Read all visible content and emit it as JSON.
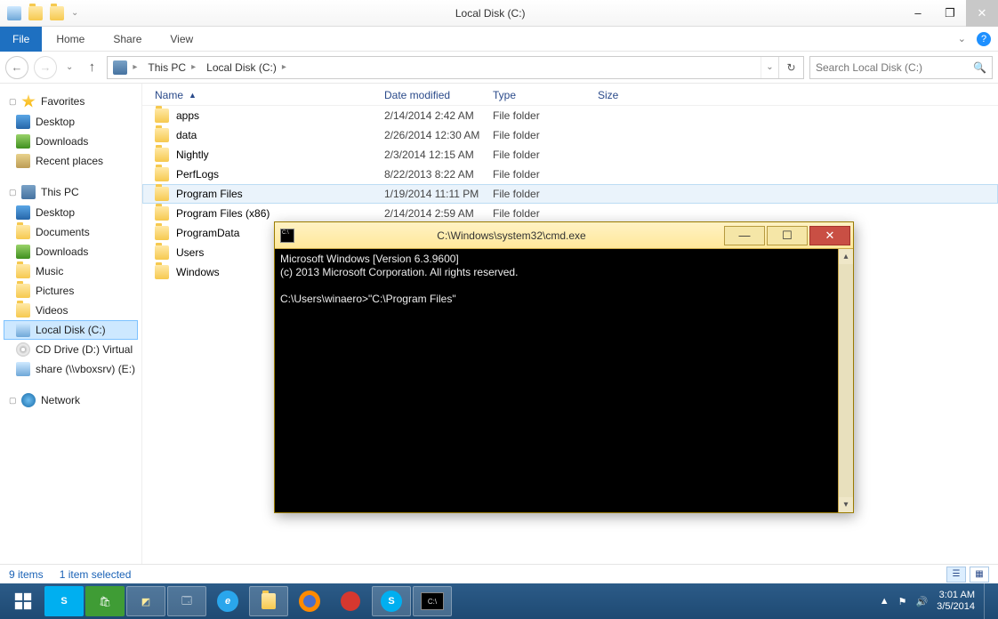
{
  "window": {
    "title": "Local Disk (C:)",
    "min_label": "–",
    "max_label": "❐",
    "close_label": "✕"
  },
  "menu": {
    "file": "File",
    "home": "Home",
    "share": "Share",
    "view": "View"
  },
  "address": {
    "root": "This PC",
    "current": "Local Disk (C:)"
  },
  "search": {
    "placeholder": "Search Local Disk (C:)"
  },
  "sidebar": {
    "favorites": "Favorites",
    "fav_items": [
      "Desktop",
      "Downloads",
      "Recent places"
    ],
    "thispc": "This PC",
    "pc_items": [
      "Desktop",
      "Documents",
      "Downloads",
      "Music",
      "Pictures",
      "Videos",
      "Local Disk (C:)",
      "CD Drive (D:) Virtual",
      "share (\\\\vboxsrv) (E:)"
    ],
    "network": "Network"
  },
  "columns": {
    "name": "Name",
    "date": "Date modified",
    "type": "Type",
    "size": "Size"
  },
  "rows": [
    {
      "name": "apps",
      "date": "2/14/2014 2:42 AM",
      "type": "File folder"
    },
    {
      "name": "data",
      "date": "2/26/2014 12:30 AM",
      "type": "File folder"
    },
    {
      "name": "Nightly",
      "date": "2/3/2014 12:15 AM",
      "type": "File folder"
    },
    {
      "name": "PerfLogs",
      "date": "8/22/2013 8:22 AM",
      "type": "File folder"
    },
    {
      "name": "Program Files",
      "date": "1/19/2014 11:11 PM",
      "type": "File folder",
      "selected": true
    },
    {
      "name": "Program Files (x86)",
      "date": "2/14/2014 2:59 AM",
      "type": "File folder"
    },
    {
      "name": "ProgramData",
      "date": "",
      "type": ""
    },
    {
      "name": "Users",
      "date": "",
      "type": ""
    },
    {
      "name": "Windows",
      "date": "",
      "type": ""
    }
  ],
  "status": {
    "items": "9 items",
    "selected": "1 item selected"
  },
  "cmd": {
    "title": "C:\\Windows\\system32\\cmd.exe",
    "line1": "Microsoft Windows [Version 6.3.9600]",
    "line2": "(c) 2013 Microsoft Corporation. All rights reserved.",
    "prompt": "C:\\Users\\winaero>\"C:\\Program Files\""
  },
  "tray": {
    "time": "3:01 AM",
    "date": "3/5/2014"
  }
}
